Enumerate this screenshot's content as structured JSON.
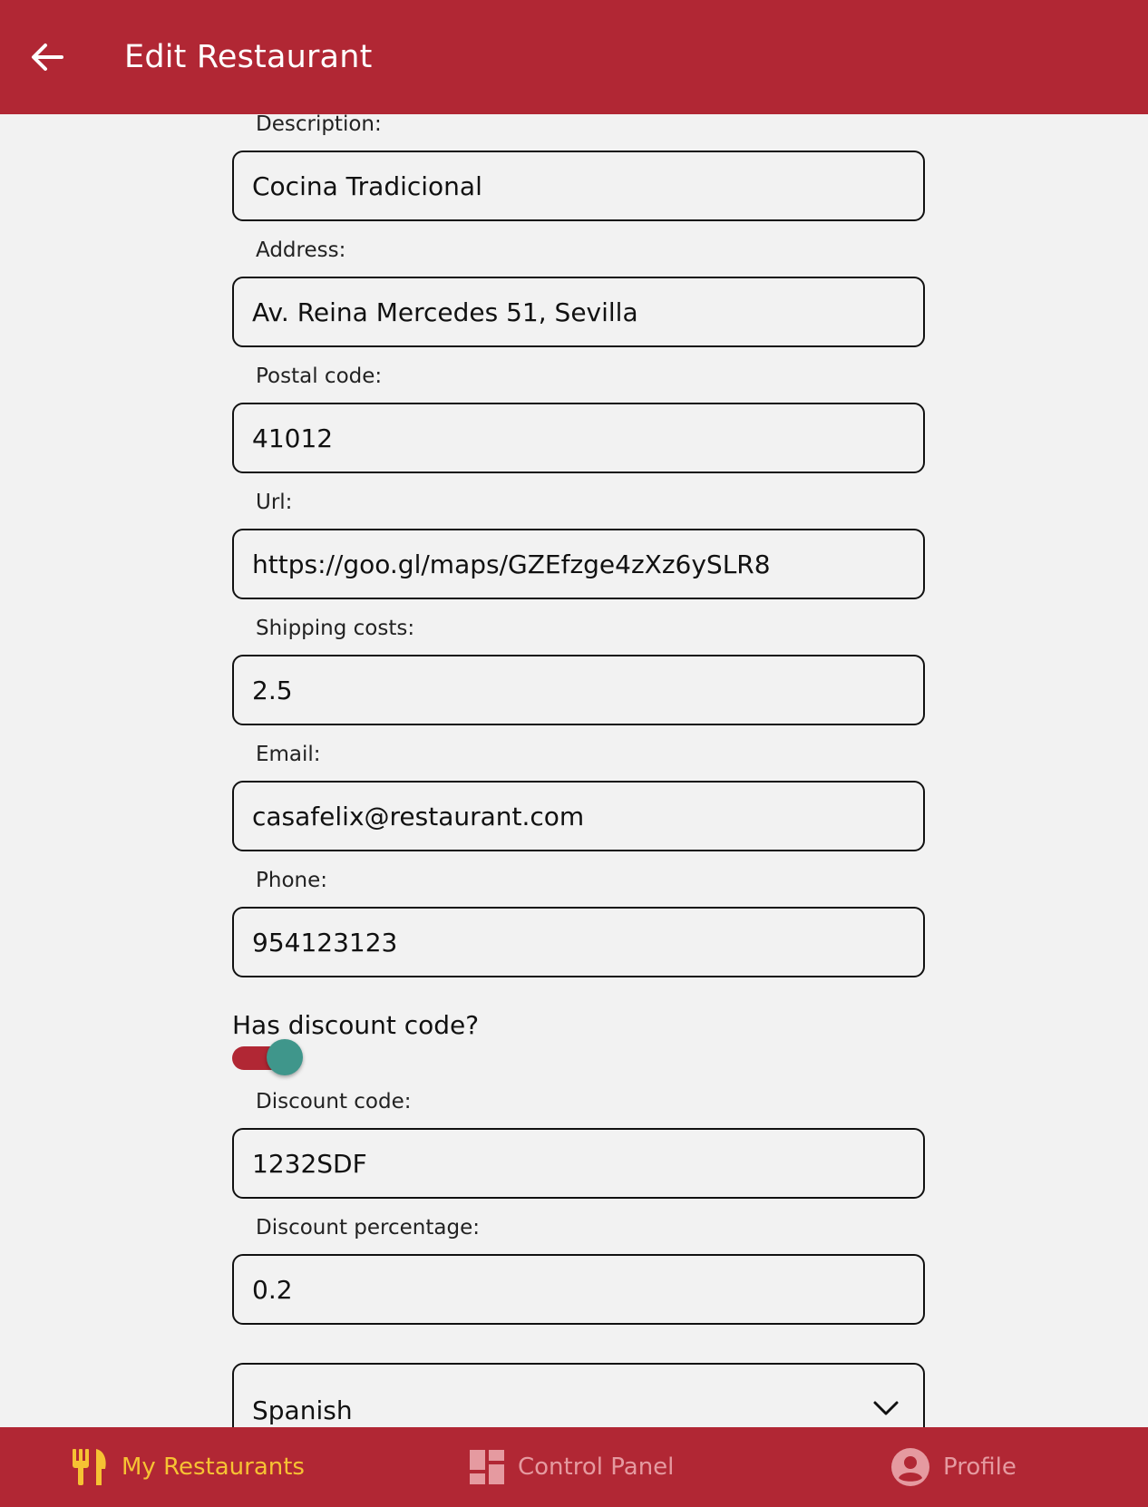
{
  "header": {
    "title": "Edit Restaurant",
    "back_icon": "arrow-left-icon"
  },
  "form": {
    "fields": [
      {
        "label": "Description:",
        "value": "Cocina Tradicional"
      },
      {
        "label": "Address:",
        "value": "Av. Reina Mercedes 51, Sevilla"
      },
      {
        "label": "Postal code:",
        "value": "41012"
      },
      {
        "label": "Url:",
        "value": "https://goo.gl/maps/GZEfzge4zXz6ySLR8"
      },
      {
        "label": "Shipping costs:",
        "value": "2.5"
      },
      {
        "label": "Email:",
        "value": "casafelix@restaurant.com"
      },
      {
        "label": "Phone:",
        "value": "954123123"
      }
    ],
    "discount_toggle": {
      "label": "Has discount code?",
      "checked": true
    },
    "discount_fields": [
      {
        "label": "Discount code:",
        "value": "1232SDF"
      },
      {
        "label": "Discount percentage:",
        "value": "0.2"
      }
    ],
    "category_select": {
      "value": "Spanish"
    }
  },
  "bottom_nav": {
    "items": [
      {
        "label": "My Restaurants",
        "icon": "restaurant-icon",
        "active": true
      },
      {
        "label": "Control Panel",
        "icon": "dashboard-icon",
        "active": false
      },
      {
        "label": "Profile",
        "icon": "account-circle-icon",
        "active": false
      }
    ]
  },
  "colors": {
    "primary": "#b12734",
    "active_nav": "#f6c233",
    "inactive_nav": "#e59aa0",
    "switch_thumb": "#3f968b",
    "background": "#f2f2f2"
  }
}
